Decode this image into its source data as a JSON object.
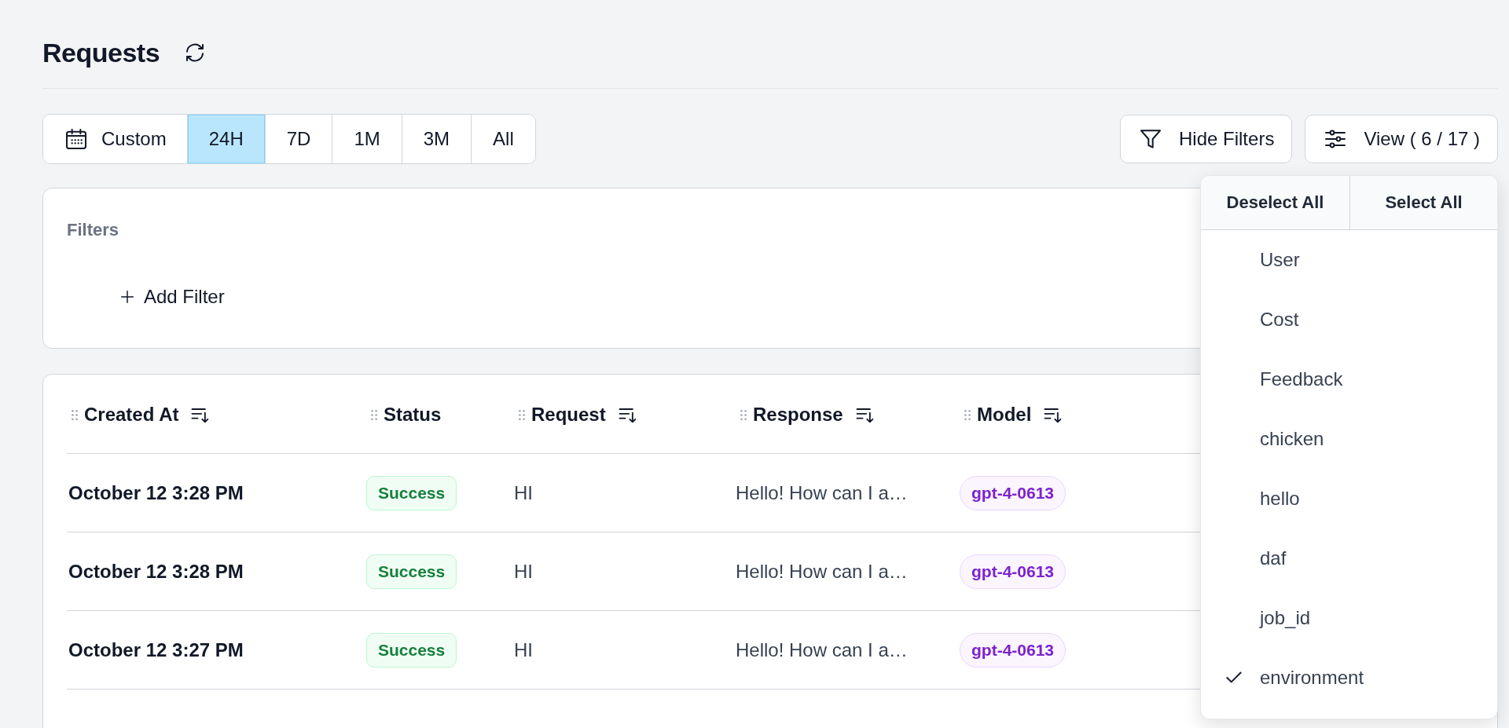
{
  "page": {
    "title": "Requests"
  },
  "time_ranges": [
    {
      "label": "Custom",
      "kind": "custom",
      "selected": false
    },
    {
      "label": "24H",
      "kind": "preset",
      "selected": true
    },
    {
      "label": "7D",
      "kind": "preset",
      "selected": false
    },
    {
      "label": "1M",
      "kind": "preset",
      "selected": false
    },
    {
      "label": "3M",
      "kind": "preset",
      "selected": false
    },
    {
      "label": "All",
      "kind": "preset",
      "selected": false
    }
  ],
  "actions": [
    {
      "label": "Hide Filters",
      "kind": "filter"
    },
    {
      "label": "View ( 6 / 17 )",
      "kind": "view"
    }
  ],
  "filters": {
    "title": "Filters",
    "add_label": "Add Filter"
  },
  "table": {
    "columns": [
      {
        "label": "Created At",
        "sortable": true
      },
      {
        "label": "Status",
        "sortable": false
      },
      {
        "label": "Request",
        "sortable": true
      },
      {
        "label": "Response",
        "sortable": true
      },
      {
        "label": "Model",
        "sortable": true
      }
    ],
    "rows": [
      {
        "created_at": "October 12 3:28 PM",
        "status": {
          "label": "Success",
          "kind": "success"
        },
        "request": "HI",
        "response": "Hello! How can I a…",
        "model": "gpt-4-0613"
      },
      {
        "created_at": "October 12 3:28 PM",
        "status": {
          "label": "Success",
          "kind": "success"
        },
        "request": "HI",
        "response": "Hello! How can I a…",
        "model": "gpt-4-0613"
      },
      {
        "created_at": "October 12 3:27 PM",
        "status": {
          "label": "Success",
          "kind": "success"
        },
        "request": "HI",
        "response": "Hello! How can I a…",
        "model": "gpt-4-0613"
      }
    ]
  },
  "view_menu": {
    "deselect_all": "Deselect All",
    "select_all": "Select All",
    "items": [
      {
        "label": "User",
        "checked": false
      },
      {
        "label": "Cost",
        "checked": false
      },
      {
        "label": "Feedback",
        "checked": false
      },
      {
        "label": "chicken",
        "checked": false
      },
      {
        "label": "hello",
        "checked": false
      },
      {
        "label": "daf",
        "checked": false
      },
      {
        "label": "job_id",
        "checked": false
      },
      {
        "label": "environment",
        "checked": true
      }
    ]
  }
}
